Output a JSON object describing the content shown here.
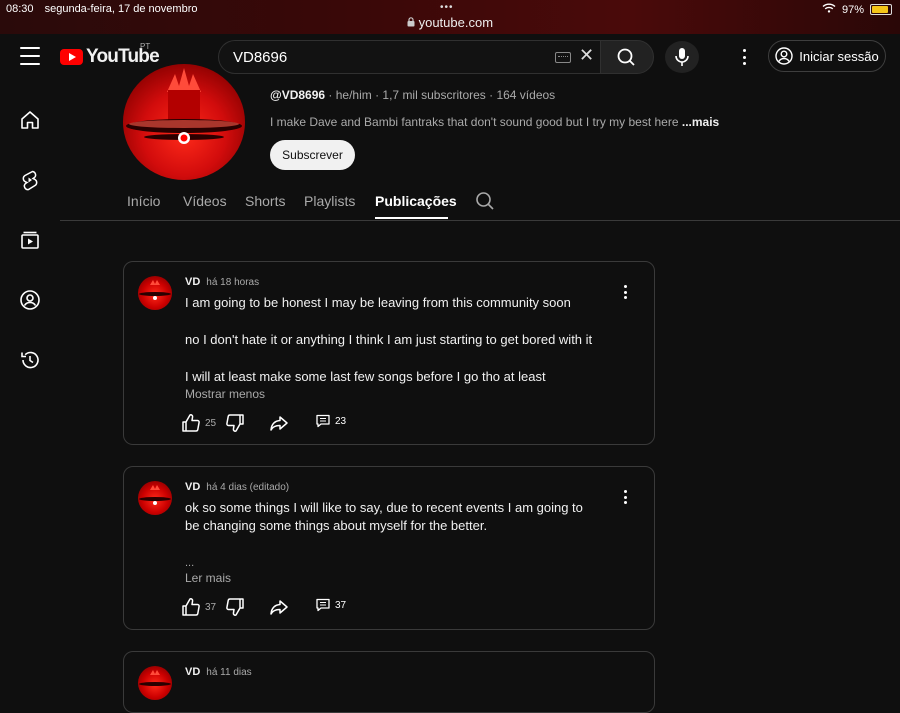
{
  "status_bar": {
    "time": "08:30",
    "date": "segunda-feira, 17 de novembro",
    "dots": "•••",
    "url": "youtube.com",
    "battery": "97%",
    "battery_level": 0.97
  },
  "header": {
    "logo_text": "YouTube",
    "country_code": "PT",
    "search_value": "VD8696",
    "signin_label": "Iniciar sessão"
  },
  "sidebar": {
    "items": [
      "home-icon",
      "shorts-icon",
      "subscriptions-icon",
      "you-icon",
      "history-icon"
    ]
  },
  "channel": {
    "handle": "@VD8696",
    "meta": " · he/him · 1,7 mil subscritores · 164 vídeos",
    "description": "I make Dave and Bambi fantraks that don't sound good but I try my best here ",
    "description_more": "...mais",
    "subscribe_label": "Subscrever"
  },
  "tabs": [
    {
      "label": "Início"
    },
    {
      "label": "Vídeos"
    },
    {
      "label": "Shorts"
    },
    {
      "label": "Playlists"
    },
    {
      "label": "Publicações",
      "active": true
    }
  ],
  "posts": [
    {
      "author": "VD",
      "time": "há 18 horas",
      "lines": [
        "I am going to be honest I may be leaving from this community soon",
        "no I don't hate it or anything I think I am just starting to get bored with it",
        "I will at least make some last few songs before I go tho at least"
      ],
      "toggle": "Mostrar menos",
      "likes": "25",
      "comments": "23"
    },
    {
      "author": "VD",
      "time": "há 4 dias (editado)",
      "lines": [
        "ok so some things I will like to say, due to recent events I am going to",
        "be changing some things about myself for the better."
      ],
      "ellipsis": "...",
      "toggle": "Ler mais",
      "likes": "37",
      "comments": "37"
    },
    {
      "author": "VD",
      "time": "há 11 dias"
    }
  ],
  "colors": {
    "brand_red": "#ff0000",
    "background": "#0f0f0f",
    "subscribe_bg": "#f1f1f1"
  }
}
